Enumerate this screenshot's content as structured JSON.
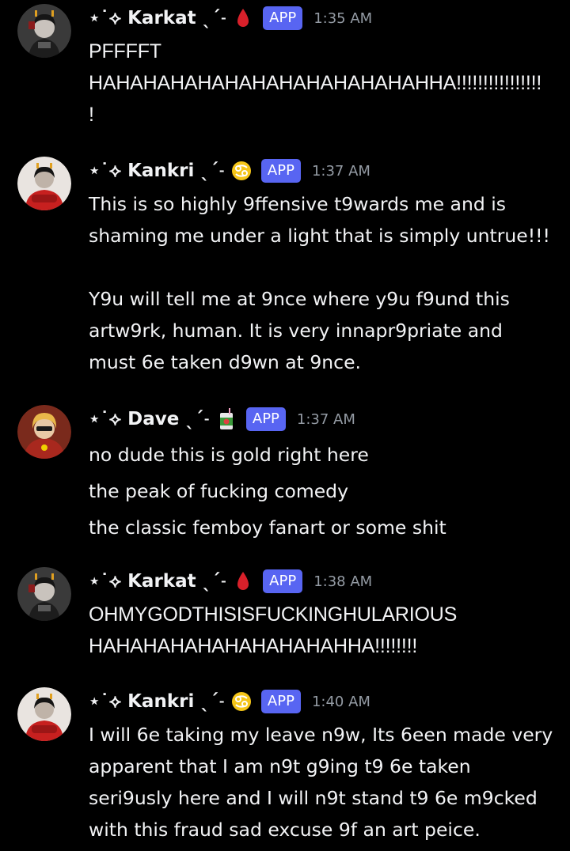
{
  "messages": [
    {
      "username": "⋆˙⟡ Karkat ˎˊ˗",
      "role_icon": "blood-drop-icon",
      "badge": "APP",
      "time": "1:35 AM",
      "lines": [
        "PFFFFT",
        "HAHAHAHAHAHAHAHAHAHAHAHAHHA!!!!!!!!!!!!!!!!",
        "!"
      ]
    },
    {
      "username": "⋆˙⟡ Kankri ˎˊ˗",
      "role_icon": "cancer-sign-icon",
      "badge": "APP",
      "time": "1:37 AM",
      "lines": [
        "This is so highly 9ffensive t9wards me and is",
        "shaming me under a light that is simply untrue!!!",
        "",
        "Y9u will tell me at 9nce where y9u f9und this",
        "artw9rk, human. It is very innapr9priate and",
        "must 6e taken d9wn at 9nce."
      ]
    },
    {
      "username": "⋆˙⟡ Dave ˎˊ˗",
      "role_icon": "apple-juice-box-icon",
      "badge": "APP",
      "time": "1:37 AM",
      "lines": [
        "no dude this is gold right here",
        "the peak of fucking comedy",
        "the classic femboy fanart or some shit"
      ]
    },
    {
      "username": "⋆˙⟡ Karkat ˎˊ˗",
      "role_icon": "blood-drop-icon",
      "badge": "APP",
      "time": "1:38 AM",
      "lines": [
        "OHMYGODTHISISFUCKINGHULARIOUS",
        "HAHAHAHAHAHAHAHAHAHHA!!!!!!!!"
      ]
    },
    {
      "username": "⋆˙⟡ Kankri ˎˊ˗",
      "role_icon": "cancer-sign-icon",
      "badge": "APP",
      "time": "1:40 AM",
      "lines": [
        "I will 6e taking my leave n9w, Its 6een made very",
        "apparent that I am n9t g9ing t9 6e taken",
        "seri9usly here and I will n9t stand t9 6e m9cked",
        "with this fraud sad excuse 9f an art peice."
      ]
    }
  ],
  "colors": {
    "background": "#000000",
    "text": "#f2f3f5",
    "timestamp": "#949ba4",
    "app_badge": "#5865f2",
    "blood_drop": "#d8202a",
    "cancer_sign": "#f5c518"
  }
}
